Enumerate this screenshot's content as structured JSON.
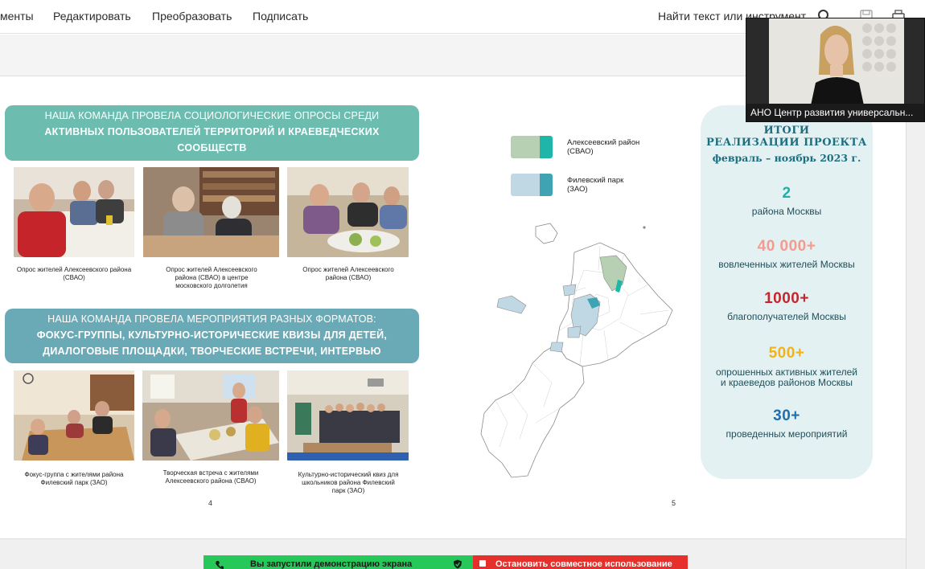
{
  "menu": {
    "items": [
      "менты",
      "Редактировать",
      "Преобразовать",
      "Подписать"
    ],
    "search_placeholder": "Найти текст или инструмент"
  },
  "slide_left": {
    "banner1": {
      "line1": "НАША КОМАНДА ПРОВЕЛА СОЦИОЛОГИЧЕСКИЕ ОПРОСЫ СРЕДИ",
      "line2": "АКТИВНЫХ ПОЛЬЗОВАТЕЛЕЙ ТЕРРИТОРИЙ И КРАЕВЕДЧЕСКИХ",
      "line3": "СООБЩЕСТВ"
    },
    "captions_row1": [
      "Опрос жителей Алексеевского района (СВАО)",
      "Опрос жителей Алексеевского района (СВАО) в центре московского долголетия",
      "Опрос жителей Алексеевского района (СВАО)"
    ],
    "banner2": {
      "line1": "НАША КОМАНДА ПРОВЕЛА МЕРОПРИЯТИЯ РАЗНЫХ ФОРМАТОВ:",
      "line2": "ФОКУС-ГРУППЫ, КУЛЬТУРНО-ИСТОРИЧЕСКИЕ КВИЗЫ ДЛЯ ДЕТЕЙ,",
      "line3": "ДИАЛОГОВЫЕ ПЛОЩАДКИ, ТВОРЧЕСКИЕ ВСТРЕЧИ, ИНТЕРВЬЮ"
    },
    "captions_row2": [
      "Фокус-группа с жителями района Филевский парк (ЗАО)",
      "Творческая встреча с жителями Алексеевского района (СВАО)",
      "Культурно-исторический квиз для школьников района Филевский парк (ЗАО)"
    ],
    "page_number": "4"
  },
  "slide_right": {
    "legend": [
      {
        "line1": "Алексеевский район",
        "line2": "(СВАО)",
        "color_light": "#b7d0b3",
        "color_dark": "#1fb5a8"
      },
      {
        "line1": "Филевский парк",
        "line2": "(ЗАО)",
        "color_light": "#c0d8e4",
        "color_dark": "#3fa3b3"
      }
    ],
    "page_number": "5",
    "results": {
      "title_line1": "ИТОГИ",
      "title_line2": "РЕАЛИЗАЦИИ ПРОЕКТА",
      "dates": "февраль – ноябрь 2023 г.",
      "stats": [
        {
          "value": "2",
          "label1": "района Москвы",
          "label2": "",
          "color": "#1fb0a8"
        },
        {
          "value": "40 000+",
          "label1": "вовлеченных жителей Москвы",
          "label2": "",
          "color": "#f29b8e"
        },
        {
          "value": "1000+",
          "label1": "благополучателей Москвы",
          "label2": "",
          "color": "#c4262e"
        },
        {
          "value": "500+",
          "label1": "опрошенных активных жителей",
          "label2": "и краеведов районов Москвы",
          "color": "#f2b218"
        },
        {
          "value": "30+",
          "label1": "проведенных мероприятий",
          "label2": "",
          "color": "#1e6fae"
        }
      ]
    }
  },
  "webcam": {
    "name": "АНО Центр развития универсальн..."
  },
  "share_bar": {
    "status": "Вы запустили демонстрацию экрана",
    "stop": "Остановить совместное использование"
  },
  "colors": {
    "banner1": "#6cbcb0",
    "banner2": "#6aaab6",
    "results_bg": "#e4f1f2",
    "share_green": "#26c85a",
    "share_red": "#e5302c"
  }
}
